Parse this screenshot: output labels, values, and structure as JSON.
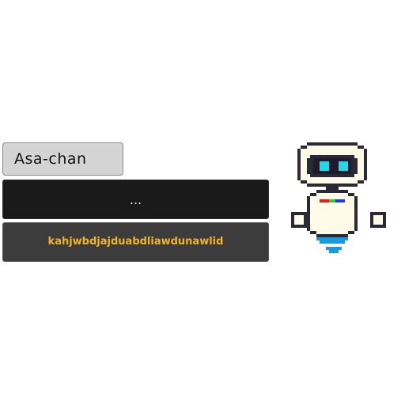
{
  "speaker": {
    "name": "Asa-chan"
  },
  "dialog": {
    "text": "..."
  },
  "choices": [
    {
      "label": "kahjwbdjajduabdliawdunawlid"
    }
  ],
  "colors": {
    "name_tag_bg": "#d4d4d4",
    "dialog_bg": "#1a1a1a",
    "choice_bg": "#3c3c3c",
    "choice_text": "#f0b429",
    "robot_eye": "#29d4e8",
    "robot_visor": "#1c1c2c",
    "robot_body": "#fdfbe8",
    "robot_outline": "#2a2a36",
    "robot_jet": "#1a9ad6"
  },
  "character": {
    "icon": "robot-character-icon"
  }
}
